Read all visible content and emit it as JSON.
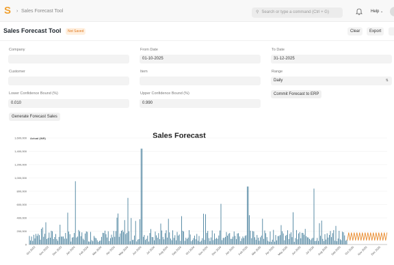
{
  "topbar": {
    "logo": "S",
    "breadcrumb_sep": "›",
    "breadcrumb": "Sales Forecast Tool",
    "search_placeholder": "Search or type a command (Ctrl + G)",
    "help_label": "Help",
    "icons": [
      "search-icon",
      "bell-icon",
      "chevron-down-icon"
    ]
  },
  "header": {
    "title": "Sales Forecast Tool",
    "status_badge": "Not Saved",
    "buttons": {
      "clear": "Clear",
      "export": "Export"
    }
  },
  "form": {
    "company": {
      "label": "Company",
      "value": ""
    },
    "from_date": {
      "label": "From Date",
      "value": "01-10-2025"
    },
    "to_date": {
      "label": "To Date",
      "value": "31-12-2025"
    },
    "customer": {
      "label": "Customer",
      "value": ""
    },
    "item": {
      "label": "Item",
      "value": ""
    },
    "range": {
      "label": "Range",
      "value": "Daily"
    },
    "lower_bound": {
      "label": "Lower Confidence Bound (%)",
      "value": "0.010"
    },
    "upper_bound": {
      "label": "Upper Confidence Bound (%)",
      "value": "0.990"
    },
    "commit_button": "Commit Forecast to ERP",
    "generate_button": "Generate Forecast Sales"
  },
  "chart_data": {
    "type": "bar",
    "title": "Sales Forecast",
    "legend": [
      "Actual (INR)"
    ],
    "series_colors": [
      "#2f6f8f",
      "#e8892b"
    ],
    "y_ticks": [
      "1,600,000",
      "1,400,000",
      "1,200,000",
      "1,000,000",
      "800,000",
      "600,000",
      "400,000",
      "200,000",
      "0"
    ],
    "ylim": [
      0,
      1600000
    ],
    "x_ticks": [
      "Oct 2023",
      "Nov 2023",
      "Dec 2023",
      "Jan 2024",
      "Feb 2024",
      "Mar 2024",
      "Apr 2024",
      "May 2024",
      "Jun 2024",
      "Jul 2024",
      "Aug 2024",
      "Sep 2024",
      "Oct 2024",
      "Nov 2024",
      "Dec 2024",
      "Jan 2025",
      "Feb 2025",
      "Mar 2025",
      "Apr 2025",
      "May 2025",
      "Jun 2025",
      "Jul 2025",
      "Aug 2025",
      "Sep 2025",
      "Oct 2025",
      "Nov 2025",
      "Dec 2025"
    ],
    "peaks": [
      {
        "month": "Jan 2024",
        "value": 950000
      },
      {
        "month": "Jun 2024",
        "value": 1440000
      },
      {
        "month": "May 2024",
        "value": 700000
      },
      {
        "month": "Dec 2024",
        "value": 610000
      },
      {
        "month": "Feb 2025",
        "value": 870000
      },
      {
        "month": "Jul 2025",
        "value": 840000
      }
    ],
    "forecast_range": [
      "Oct 2025",
      "Dec 2025"
    ],
    "forecast_level": 120000
  }
}
